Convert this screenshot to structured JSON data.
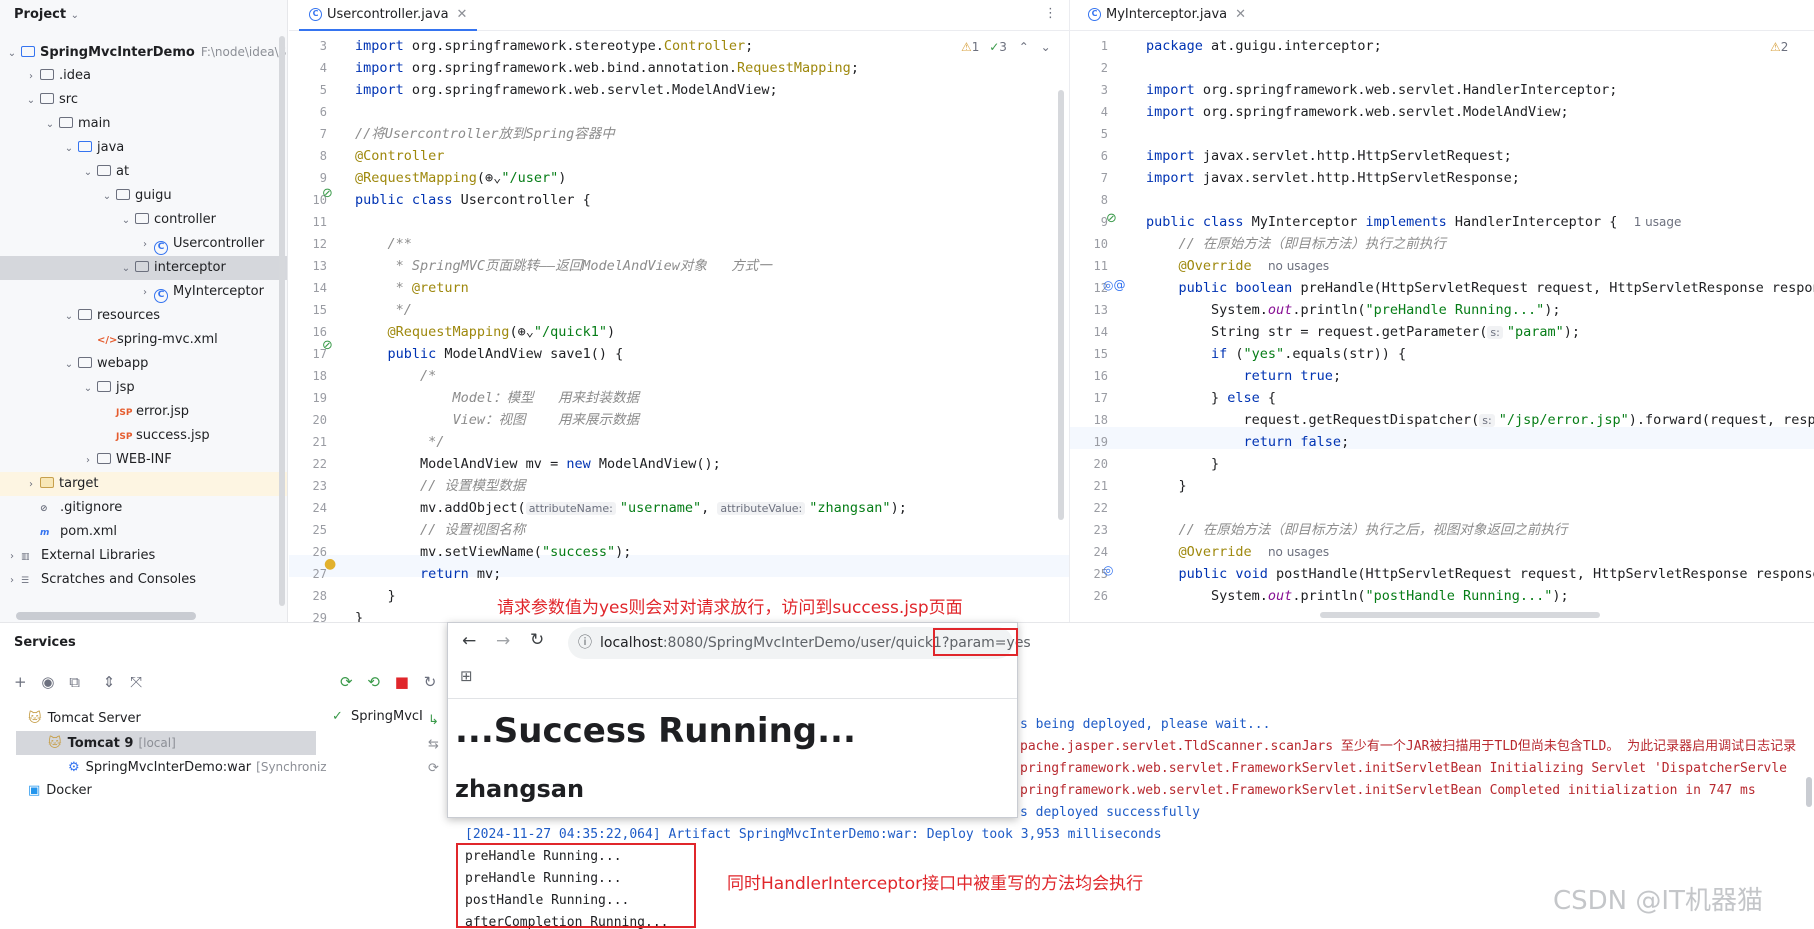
{
  "project": {
    "title": "Project",
    "tree": [
      {
        "label": "SpringMvcInterDemo",
        "extra": "F:\\node\\idea\\Spring",
        "depth": 0,
        "kind": "module",
        "expanded": true
      },
      {
        "label": ".idea",
        "depth": 1,
        "kind": "folder",
        "expanded": false
      },
      {
        "label": "src",
        "depth": 1,
        "kind": "folder",
        "expanded": true
      },
      {
        "label": "main",
        "depth": 2,
        "kind": "folder",
        "expanded": true
      },
      {
        "label": "java",
        "depth": 3,
        "kind": "src",
        "expanded": true
      },
      {
        "label": "at",
        "depth": 4,
        "kind": "package",
        "expanded": true
      },
      {
        "label": "guigu",
        "depth": 5,
        "kind": "package",
        "expanded": true
      },
      {
        "label": "controller",
        "depth": 6,
        "kind": "package",
        "expanded": true
      },
      {
        "label": "Usercontroller",
        "depth": 7,
        "kind": "class",
        "expanded": false
      },
      {
        "label": "interceptor",
        "depth": 6,
        "kind": "package",
        "expanded": true
      },
      {
        "label": "MyInterceptor",
        "depth": 7,
        "kind": "class",
        "expanded": false
      },
      {
        "label": "resources",
        "depth": 3,
        "kind": "folder",
        "expanded": true
      },
      {
        "label": "spring-mvc.xml",
        "depth": 4,
        "kind": "xml"
      },
      {
        "label": "webapp",
        "depth": 3,
        "kind": "folder",
        "expanded": true
      },
      {
        "label": "jsp",
        "depth": 4,
        "kind": "folder",
        "expanded": true
      },
      {
        "label": "error.jsp",
        "depth": 5,
        "kind": "jsp"
      },
      {
        "label": "success.jsp",
        "depth": 5,
        "kind": "jsp"
      },
      {
        "label": "WEB-INF",
        "depth": 4,
        "kind": "folder",
        "expanded": false
      },
      {
        "label": "target",
        "depth": 1,
        "kind": "target",
        "expanded": false
      },
      {
        "label": ".gitignore",
        "depth": 1,
        "kind": "gitignore"
      },
      {
        "label": "pom.xml",
        "depth": 1,
        "kind": "maven"
      },
      {
        "label": "External Libraries",
        "depth": 0,
        "kind": "lib",
        "expanded": false
      },
      {
        "label": "Scratches and Consoles",
        "depth": 0,
        "kind": "scratch",
        "expanded": false
      }
    ]
  },
  "editor_left": {
    "tab": "Usercontroller.java",
    "inspections": {
      "warnings": "1",
      "checks": "3"
    },
    "first_line": 3,
    "lines": [
      [
        {
          "t": "import ",
          "c": "kw"
        },
        {
          "t": "org.springframework.stereotype."
        },
        {
          "t": "Controller",
          "c": "an"
        },
        {
          "t": ";"
        }
      ],
      [
        {
          "t": "import ",
          "c": "kw"
        },
        {
          "t": "org.springframework.web.bind.annotation."
        },
        {
          "t": "RequestMapping",
          "c": "an"
        },
        {
          "t": ";"
        }
      ],
      [
        {
          "t": "import ",
          "c": "kw"
        },
        {
          "t": "org.springframework.web.servlet.ModelAndView;"
        }
      ],
      [],
      [
        {
          "t": "//将Usercontroller放到Spring容器中",
          "c": "cm"
        }
      ],
      [
        {
          "t": "@Controller",
          "c": "an"
        }
      ],
      [
        {
          "t": "@RequestMapping",
          "c": "an"
        },
        {
          "t": "(⊕⌄"
        },
        {
          "t": "\"/user\"",
          "c": "st"
        },
        {
          "t": ")"
        }
      ],
      [
        {
          "t": "public class ",
          "c": "kw"
        },
        {
          "t": "Usercontroller {"
        }
      ],
      [],
      [
        {
          "t": "    /**",
          "c": "cm"
        }
      ],
      [
        {
          "t": "     * SpringMVC页面跳转——返回ModelAndView对象   方式一",
          "c": "cm"
        }
      ],
      [
        {
          "t": "     * ",
          "c": "cm"
        },
        {
          "t": "@return",
          "c": "an"
        }
      ],
      [
        {
          "t": "     */",
          "c": "cm"
        }
      ],
      [
        {
          "t": "    "
        },
        {
          "t": "@RequestMapping",
          "c": "an"
        },
        {
          "t": "(⊕⌄"
        },
        {
          "t": "\"/quick1\"",
          "c": "st"
        },
        {
          "t": ")"
        }
      ],
      [
        {
          "t": "    public ",
          "c": "kw"
        },
        {
          "t": "ModelAndView save1() {"
        }
      ],
      [
        {
          "t": "        /*",
          "c": "cm"
        }
      ],
      [
        {
          "t": "            Model：模型   用来封装数据",
          "c": "cm"
        }
      ],
      [
        {
          "t": "            View：视图    用来展示数据",
          "c": "cm"
        }
      ],
      [
        {
          "t": "         */",
          "c": "cm"
        }
      ],
      [
        {
          "t": "        ModelAndView mv = "
        },
        {
          "t": "new ",
          "c": "kw"
        },
        {
          "t": "ModelAndView();"
        }
      ],
      [
        {
          "t": "        // 设置模型数据",
          "c": "cm"
        }
      ],
      [
        {
          "t": "        mv.addObject("
        },
        {
          "h": "attributeName:"
        },
        {
          "t": "\"username\"",
          "c": "st"
        },
        {
          "t": ", "
        },
        {
          "h": "attributeValue:"
        },
        {
          "t": "\"zhangsan\"",
          "c": "st"
        },
        {
          "t": ");"
        }
      ],
      [
        {
          "t": "        // 设置视图名称",
          "c": "cm"
        }
      ],
      [
        {
          "t": "        mv.setViewName("
        },
        {
          "t": "\"success\"",
          "c": "st"
        },
        {
          "t": ");"
        }
      ],
      [
        {
          "t": "        return ",
          "c": "kw"
        },
        {
          "t": "mv;"
        }
      ],
      [
        {
          "t": "    }"
        }
      ],
      [
        {
          "t": "}"
        }
      ]
    ]
  },
  "editor_right": {
    "tab": "MyInterceptor.java",
    "inspections": {
      "warnings": "2"
    },
    "first_line": 1,
    "lines": [
      [
        {
          "t": "package ",
          "c": "kw"
        },
        {
          "t": "at.guigu.interceptor;"
        }
      ],
      [],
      [
        {
          "t": "import ",
          "c": "kw"
        },
        {
          "t": "org.springframework.web.servlet.HandlerInterceptor;"
        }
      ],
      [
        {
          "t": "import ",
          "c": "kw"
        },
        {
          "t": "org.springframework.web.servlet.ModelAndView;"
        }
      ],
      [],
      [
        {
          "t": "import ",
          "c": "kw"
        },
        {
          "t": "javax.servlet.http.HttpServletRequest;"
        }
      ],
      [
        {
          "t": "import ",
          "c": "kw"
        },
        {
          "t": "javax.servlet.http.HttpServletResponse;"
        }
      ],
      [],
      [
        {
          "t": "public class ",
          "c": "kw"
        },
        {
          "t": "MyInterceptor "
        },
        {
          "t": "implements ",
          "c": "kw"
        },
        {
          "t": "HandlerInterceptor {  "
        },
        {
          "u": "1 usage"
        }
      ],
      [
        {
          "t": "    // 在原始方法（即目标方法）执行之前执行",
          "c": "cm"
        }
      ],
      [
        {
          "t": "    "
        },
        {
          "t": "@Override",
          "c": "an"
        },
        {
          "t": "  "
        },
        {
          "u": "no usages"
        }
      ],
      [
        {
          "t": "    public boolean ",
          "c": "kw"
        },
        {
          "t": "preHandle(HttpServletRequest request, HttpServletResponse respon"
        }
      ],
      [
        {
          "t": "        System."
        },
        {
          "t": "out",
          "c": "fld"
        },
        {
          "t": ".println("
        },
        {
          "t": "\"preHandle Running...\"",
          "c": "st"
        },
        {
          "t": ");"
        }
      ],
      [
        {
          "t": "        String str = request.getParameter("
        },
        {
          "h": "s:"
        },
        {
          "t": "\"param\"",
          "c": "st"
        },
        {
          "t": ");"
        }
      ],
      [
        {
          "t": "        if ",
          "c": "kw"
        },
        {
          "t": "("
        },
        {
          "t": "\"yes\"",
          "c": "st"
        },
        {
          "t": ".equals(str)) {"
        }
      ],
      [
        {
          "t": "            return true",
          "c": "kw"
        },
        {
          "t": ";"
        }
      ],
      [
        {
          "t": "        } "
        },
        {
          "t": "else ",
          "c": "kw"
        },
        {
          "t": "{"
        }
      ],
      [
        {
          "t": "            request.getRequestDispatcher("
        },
        {
          "h": "s:"
        },
        {
          "t": "\"/jsp/error.jsp\"",
          "c": "st"
        },
        {
          "t": ").forward(request, resp"
        }
      ],
      [
        {
          "t": "            return false",
          "c": "kw"
        },
        {
          "t": ";"
        }
      ],
      [
        {
          "t": "        }"
        }
      ],
      [
        {
          "t": "    }"
        }
      ],
      [],
      [
        {
          "t": "    // 在原始方法（即目标方法）执行之后，视图对象返回之前执行",
          "c": "cm"
        }
      ],
      [
        {
          "t": "    "
        },
        {
          "t": "@Override",
          "c": "an"
        },
        {
          "t": "  "
        },
        {
          "u": "no usages"
        }
      ],
      [
        {
          "t": "    public void ",
          "c": "kw"
        },
        {
          "t": "postHandle(HttpServletRequest request, HttpServletResponse response"
        }
      ],
      [
        {
          "t": "        System."
        },
        {
          "t": "out",
          "c": "fld"
        },
        {
          "t": ".println("
        },
        {
          "t": "\"postHandle Running...\"",
          "c": "st"
        },
        {
          "t": ");"
        }
      ]
    ]
  },
  "annotations": {
    "top": "请求参数值为yes则会对对请求放行，访问到success.jsp页面",
    "bottom": "同时HandlerInterceptor接口中被重写的方法均会执行"
  },
  "services": {
    "title": "Services",
    "tree": [
      {
        "label": "Tomcat Server",
        "depth": 1
      },
      {
        "label": "Tomcat 9",
        "extra": "[local]",
        "depth": 2,
        "selected": true
      },
      {
        "label": "SpringMvcInterDemo:war",
        "extra": "[Synchroniz",
        "depth": 3
      },
      {
        "label": "Docker",
        "depth": 1
      }
    ],
    "deployment": "SpringMvcI"
  },
  "browser": {
    "url_host": "localhost",
    "url_rest": ":8080/SpringMvcInterDemo/user/quick1",
    "url_query": "?param=yes",
    "heading": "...Success Running...",
    "username": "zhangsan"
  },
  "console": {
    "lines": [
      {
        "t": "s being deployed, please wait...",
        "c": "c-blue"
      },
      {
        "t": "pache.jasper.servlet.TldScanner.scanJars 至少有一个JAR被扫描用于TLD但尚未包含TLD。 为此记录器启用调试日志记录",
        "c": "c-red"
      },
      {
        "t": "pringframework.web.servlet.FrameworkServlet.initServletBean Initializing Servlet 'DispatcherServle",
        "c": "c-red"
      },
      {
        "t": "pringframework.web.servlet.FrameworkServlet.initServletBean Completed initialization in 747 ms",
        "c": "c-red"
      },
      {
        "t": "s deployed successfully",
        "c": "c-blue"
      }
    ],
    "full_lines": [
      {
        "t": "[2024-11-27 04:35:22,064] Artifact SpringMvcInterDemo:war: Deploy took 3,953 milliseconds",
        "c": "c-blue"
      },
      {
        "t": "preHandle Running..."
      },
      {
        "t": "preHandle Running..."
      },
      {
        "t": "postHandle Running..."
      },
      {
        "t": "afterCompletion Running..."
      }
    ]
  },
  "watermark": "CSDN @IT机器猫"
}
